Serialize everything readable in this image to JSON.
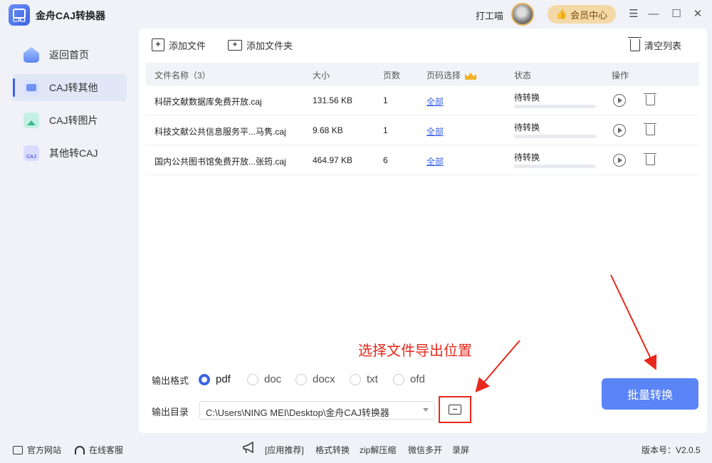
{
  "app": {
    "title": "金舟CAJ转换器",
    "logo_text": "CAJ",
    "username": "打工喵",
    "vip_label": "会员中心"
  },
  "sidebar": {
    "items": [
      {
        "label": "返回首页",
        "icon": "home-icon"
      },
      {
        "label": "CAJ转其他",
        "icon": "caj-to-other-icon",
        "active": true
      },
      {
        "label": "CAJ转图片",
        "icon": "caj-to-image-icon"
      },
      {
        "label": "其他转CAJ",
        "icon": "other-to-caj-icon"
      }
    ]
  },
  "toolbar": {
    "add_file": "添加文件",
    "add_folder": "添加文件夹",
    "clear_list": "清空列表"
  },
  "table": {
    "headers": {
      "name": "文件名称（3）",
      "size": "大小",
      "pages": "页数",
      "page_select": "页码选择",
      "status": "状态",
      "actions": "操作"
    },
    "rows": [
      {
        "name": "科研文献数据库免费开放.caj",
        "size": "131.56 KB",
        "pages": "1",
        "range": "全部",
        "status": "待转换",
        "progress": 0
      },
      {
        "name": "科技文献公共信息服务平...马隽.caj",
        "size": "9.68 KB",
        "pages": "1",
        "range": "全部",
        "status": "待转换",
        "progress": 0
      },
      {
        "name": "国内公共图书馆免费开放...张筠.caj",
        "size": "464.97 KB",
        "pages": "6",
        "range": "全部",
        "status": "待转换",
        "progress": 0
      }
    ]
  },
  "annotation": "选择文件导出位置",
  "output": {
    "format_label": "输出格式",
    "formats": [
      "pdf",
      "doc",
      "docx",
      "txt",
      "ofd"
    ],
    "selected_format": "pdf",
    "dir_label": "输出目录",
    "dir_value": "C:\\Users\\NING MEI\\Desktop\\金舟CAJ转换器"
  },
  "convert_button": "批量转换",
  "footer": {
    "official_site": "官方网站",
    "online_service": "在线客服",
    "recommend": "[应用推荐]",
    "links": [
      "格式转换",
      "zip解压缩",
      "微信多开",
      "录屏"
    ],
    "version": "版本号：V2.0.5"
  },
  "colors": {
    "accent": "#3b63e6",
    "button": "#5b84f7",
    "annotation": "#e8281c",
    "vip_bg": "#f4d9a6"
  }
}
